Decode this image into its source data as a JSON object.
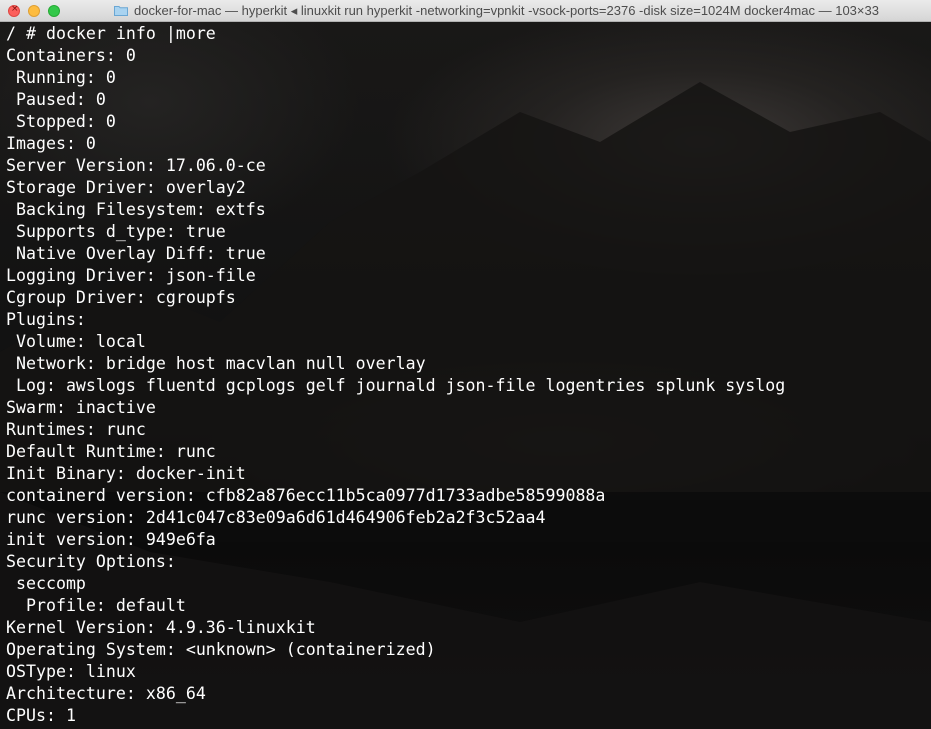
{
  "window": {
    "title": "docker-for-mac — hyperkit ◂ linuxkit run hyperkit -networking=vpnkit -vsock-ports=2376 -disk size=1024M docker4mac — 103×33"
  },
  "terminal": {
    "lines": [
      "/ # docker info |more",
      "Containers: 0",
      " Running: 0",
      " Paused: 0",
      " Stopped: 0",
      "Images: 0",
      "Server Version: 17.06.0-ce",
      "Storage Driver: overlay2",
      " Backing Filesystem: extfs",
      " Supports d_type: true",
      " Native Overlay Diff: true",
      "Logging Driver: json-file",
      "Cgroup Driver: cgroupfs",
      "Plugins:",
      " Volume: local",
      " Network: bridge host macvlan null overlay",
      " Log: awslogs fluentd gcplogs gelf journald json-file logentries splunk syslog",
      "Swarm: inactive",
      "Runtimes: runc",
      "Default Runtime: runc",
      "Init Binary: docker-init",
      "containerd version: cfb82a876ecc11b5ca0977d1733adbe58599088a",
      "runc version: 2d41c047c83e09a6d61d464906feb2a2f3c52aa4",
      "init version: 949e6fa",
      "Security Options:",
      " seccomp",
      "  Profile: default",
      "Kernel Version: 4.9.36-linuxkit",
      "Operating System: <unknown> (containerized)",
      "OSType: linux",
      "Architecture: x86_64",
      "CPUs: 1"
    ]
  },
  "colors": {
    "text": "#ffffff",
    "close": "#fc605c",
    "minimize": "#fdbc40",
    "maximize": "#34c84a"
  },
  "icons": {
    "close": "close-icon",
    "folder": "folder-icon"
  }
}
